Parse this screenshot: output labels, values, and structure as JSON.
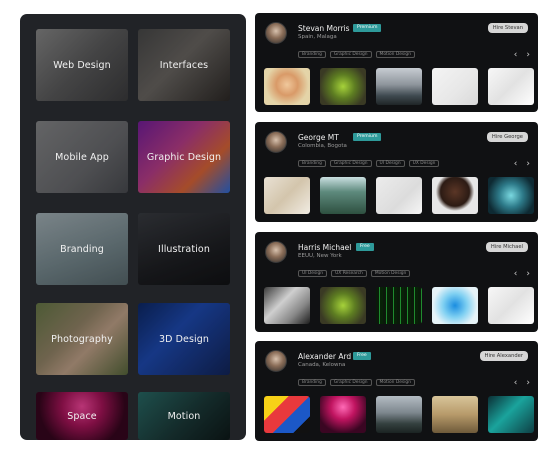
{
  "categories": [
    {
      "label": "Web Design",
      "palette": "web",
      "icon": "web-design-thumbnail"
    },
    {
      "label": "Interfaces",
      "palette": "int",
      "icon": "interfaces-thumbnail"
    },
    {
      "label": "Mobile App",
      "palette": "mob",
      "icon": "mobile-app-thumbnail"
    },
    {
      "label": "Graphic Design",
      "palette": "gra",
      "icon": "graphic-design-thumbnail"
    },
    {
      "label": "Branding",
      "palette": "bra",
      "icon": "branding-thumbnail"
    },
    {
      "label": "Illustration",
      "palette": "ill",
      "icon": "illustration-thumbnail"
    },
    {
      "label": "Photography",
      "palette": "pho",
      "icon": "photography-thumbnail"
    },
    {
      "label": "3D Design",
      "palette": "3d",
      "icon": "3d-design-thumbnail"
    },
    {
      "label": "Space",
      "palette": "spa",
      "icon": "space-thumbnail"
    },
    {
      "label": "Motion",
      "palette": "mot",
      "icon": "motion-thumbnail"
    }
  ],
  "designers": [
    {
      "name": "Stevan Morris",
      "location": "Spain, Malaga",
      "badge": "Premium",
      "hire_label": "Hire Stevan",
      "tags": [
        "Branding",
        "Graphic Design",
        "Motion Design"
      ],
      "thumbs": [
        "face",
        "leaf",
        "sea",
        "hand",
        "white"
      ]
    },
    {
      "name": "George MT",
      "location": "Colombia, Bogota",
      "badge": "Premium",
      "hire_label": "Hire George",
      "tags": [
        "Branding",
        "Graphic Design",
        "UI Design",
        "UX Design"
      ],
      "thumbs": [
        "wheat",
        "forest",
        "paper",
        "smile",
        "burst"
      ]
    },
    {
      "name": "Harris Michael",
      "location": "EEUU, New York",
      "badge": "Free",
      "hire_label": "Hire Michael",
      "tags": [
        "UI Design",
        "UX Research",
        "Motion Design"
      ],
      "thumbs": [
        "laptop",
        "leaf",
        "matrix",
        "ink",
        "white"
      ]
    },
    {
      "name": "Alexander Ard",
      "location": "Canada, Kelowna",
      "badge": "Free",
      "hire_label": "Hire Alexander",
      "tags": [
        "Branding",
        "Graphic Design",
        "Motion Design"
      ],
      "thumbs": [
        "shapes",
        "dots",
        "sea2",
        "room",
        "aqua"
      ]
    }
  ],
  "colors": {
    "panel_bg": "#212327",
    "card_bg": "#101113",
    "badge_bg": "#2e9a9a",
    "hire_bg": "#d6d6d6"
  }
}
